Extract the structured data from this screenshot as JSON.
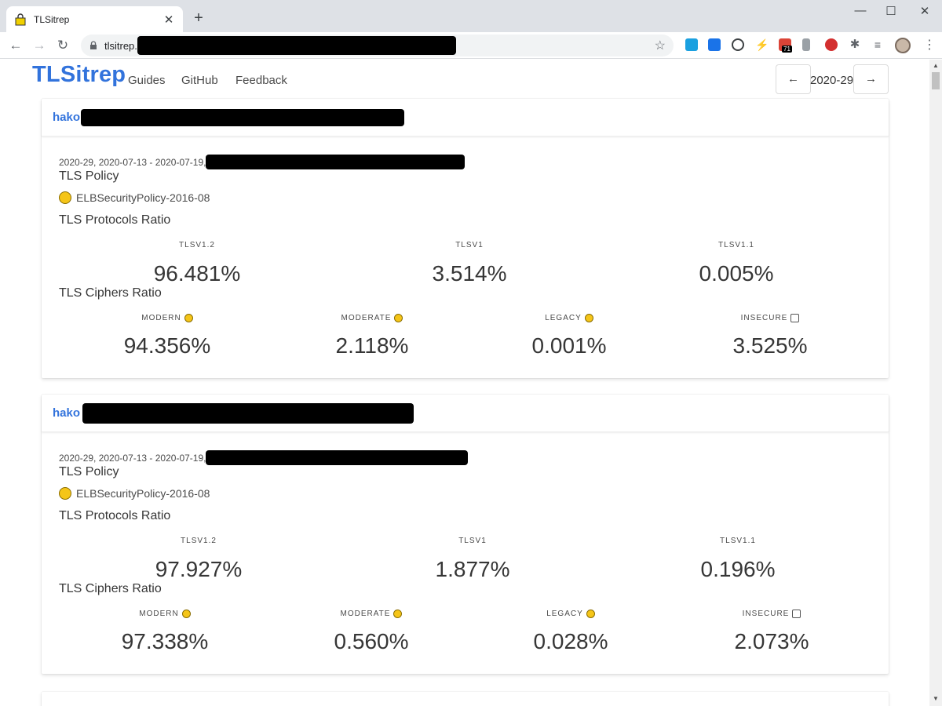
{
  "browser": {
    "tab_title": "TLSitrep",
    "url_prefix": "tlsitrep.",
    "new_tab": "+",
    "back": "←",
    "forward": "→",
    "reload": "↻",
    "star": "☆",
    "minimize": "—",
    "maximize": "☐",
    "close": "✕",
    "tab_close": "✕",
    "menu": "⋮",
    "extension_badge": "71"
  },
  "site": {
    "logo": "TLSitrep",
    "nav": [
      "Guides",
      "GitHub",
      "Feedback"
    ],
    "prev": "←",
    "next": "→",
    "week": "2020-29"
  },
  "cards": [
    {
      "host_prefix": "hako",
      "meta": "2020-29, 2020-07-13 - 2020-07-19,",
      "policy_heading": "TLS Policy",
      "policy_name": "ELBSecurityPolicy-2016-08",
      "protocols_heading": "TLS Protocols Ratio",
      "protocols": [
        {
          "label": "TLSV1.2",
          "value": "96.481%"
        },
        {
          "label": "TLSV1",
          "value": "3.514%"
        },
        {
          "label": "TLSV1.1",
          "value": "0.005%"
        }
      ],
      "ciphers_heading": "TLS Ciphers Ratio",
      "ciphers": [
        {
          "label": "MODERN",
          "value": "94.356%",
          "icon": "cool-emoji-icon"
        },
        {
          "label": "MODERATE",
          "value": "2.118%",
          "icon": "smile-emoji-icon"
        },
        {
          "label": "LEGACY",
          "value": "0.001%",
          "icon": "worried-emoji-icon"
        },
        {
          "label": "INSECURE",
          "value": "3.525%",
          "icon": "skull-crossbones-icon"
        }
      ]
    },
    {
      "host_prefix": "hako",
      "meta": "2020-29, 2020-07-13 - 2020-07-19,",
      "policy_heading": "TLS Policy",
      "policy_name": "ELBSecurityPolicy-2016-08",
      "protocols_heading": "TLS Protocols Ratio",
      "protocols": [
        {
          "label": "TLSV1.2",
          "value": "97.927%"
        },
        {
          "label": "TLSV1",
          "value": "1.877%"
        },
        {
          "label": "TLSV1.1",
          "value": "0.196%"
        }
      ],
      "ciphers_heading": "TLS Ciphers Ratio",
      "ciphers": [
        {
          "label": "MODERN",
          "value": "97.338%",
          "icon": "cool-emoji-icon"
        },
        {
          "label": "MODERATE",
          "value": "0.560%",
          "icon": "smile-emoji-icon"
        },
        {
          "label": "LEGACY",
          "value": "0.028%",
          "icon": "worried-emoji-icon"
        },
        {
          "label": "INSECURE",
          "value": "2.073%",
          "icon": "skull-crossbones-icon"
        }
      ]
    }
  ]
}
